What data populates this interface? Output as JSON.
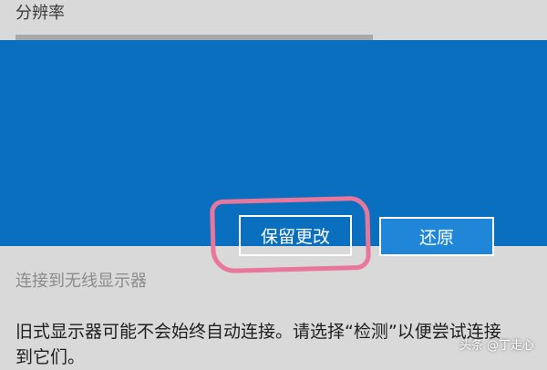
{
  "settings": {
    "resolution_label": "分辨率",
    "wireless_link": "连接到无线显示器",
    "info_line1": "旧式显示器可能不会始终自动连接。请选择“检测”以便尝试连接",
    "info_line2": "到它们。"
  },
  "dialog": {
    "keep_button": "保留更改",
    "revert_button": "还原"
  },
  "watermark": {
    "text": "头条 @丁走心"
  },
  "colors": {
    "dialog_background": "#0b6fbf",
    "page_background": "#d9d9d9",
    "highlight_ring": "#e8779b"
  }
}
